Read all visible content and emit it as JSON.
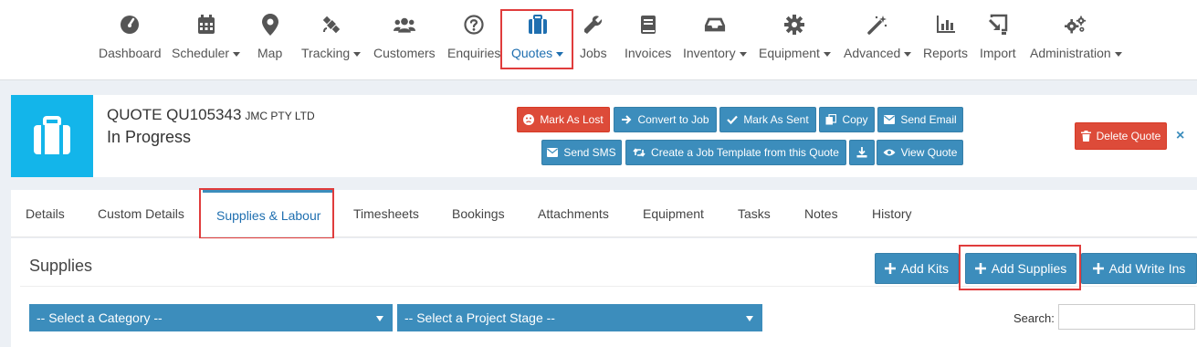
{
  "nav": {
    "items": [
      {
        "label": "Dashboard",
        "icon": "dashboard-gauge-icon",
        "caret": false
      },
      {
        "label": "Scheduler",
        "icon": "calendar-icon",
        "caret": true
      },
      {
        "label": "Map",
        "icon": "map-marker-icon",
        "caret": false
      },
      {
        "label": "Tracking",
        "icon": "satellite-icon",
        "caret": true
      },
      {
        "label": "Customers",
        "icon": "users-icon",
        "caret": false
      },
      {
        "label": "Enquiries",
        "icon": "question-circle-icon",
        "caret": false
      },
      {
        "label": "Quotes",
        "icon": "briefcase-icon",
        "caret": true,
        "active": true
      },
      {
        "label": "Jobs",
        "icon": "wrench-icon",
        "caret": false
      },
      {
        "label": "Invoices",
        "icon": "book-icon",
        "caret": false
      },
      {
        "label": "Inventory",
        "icon": "inbox-tray-icon",
        "caret": true
      },
      {
        "label": "Equipment",
        "icon": "cog-icon",
        "caret": true
      },
      {
        "label": "Advanced",
        "icon": "magic-wand-icon",
        "caret": true
      },
      {
        "label": "Reports",
        "icon": "bar-chart-icon",
        "caret": false
      },
      {
        "label": "Import",
        "icon": "import-icon",
        "caret": false
      },
      {
        "label": "Administration",
        "icon": "cogs-icon",
        "caret": true
      }
    ]
  },
  "quote": {
    "title": "QUOTE QU105343",
    "customer": "JMC PTY LTD",
    "status": "In Progress"
  },
  "actions": {
    "mark_as_lost": "Mark As Lost",
    "convert_to_job": "Convert to Job",
    "mark_as_sent": "Mark As Sent",
    "copy": "Copy",
    "send_email": "Send Email",
    "send_sms": "Send SMS",
    "create_template": "Create a Job Template from this Quote",
    "view_quote": "View Quote",
    "delete_quote": "Delete Quote",
    "close": "×"
  },
  "tabs": [
    "Details",
    "Custom Details",
    "Supplies & Labour",
    "Timesheets",
    "Bookings",
    "Attachments",
    "Equipment",
    "Tasks",
    "Notes",
    "History"
  ],
  "active_tab": "Supplies & Labour",
  "supplies": {
    "title": "Supplies",
    "add_kits": "Add Kits",
    "add_supplies": "Add Supplies",
    "add_write_ins": "Add Write Ins",
    "category_select": "-- Select a Category --",
    "stage_select": "-- Select a Project Stage --",
    "search_label": "Search:",
    "search_value": ""
  },
  "colors": {
    "accent": "#3c8dbc",
    "danger": "#dd4b39",
    "quote_icon_bg": "#13b5ea",
    "highlight": "#e03c3c"
  }
}
